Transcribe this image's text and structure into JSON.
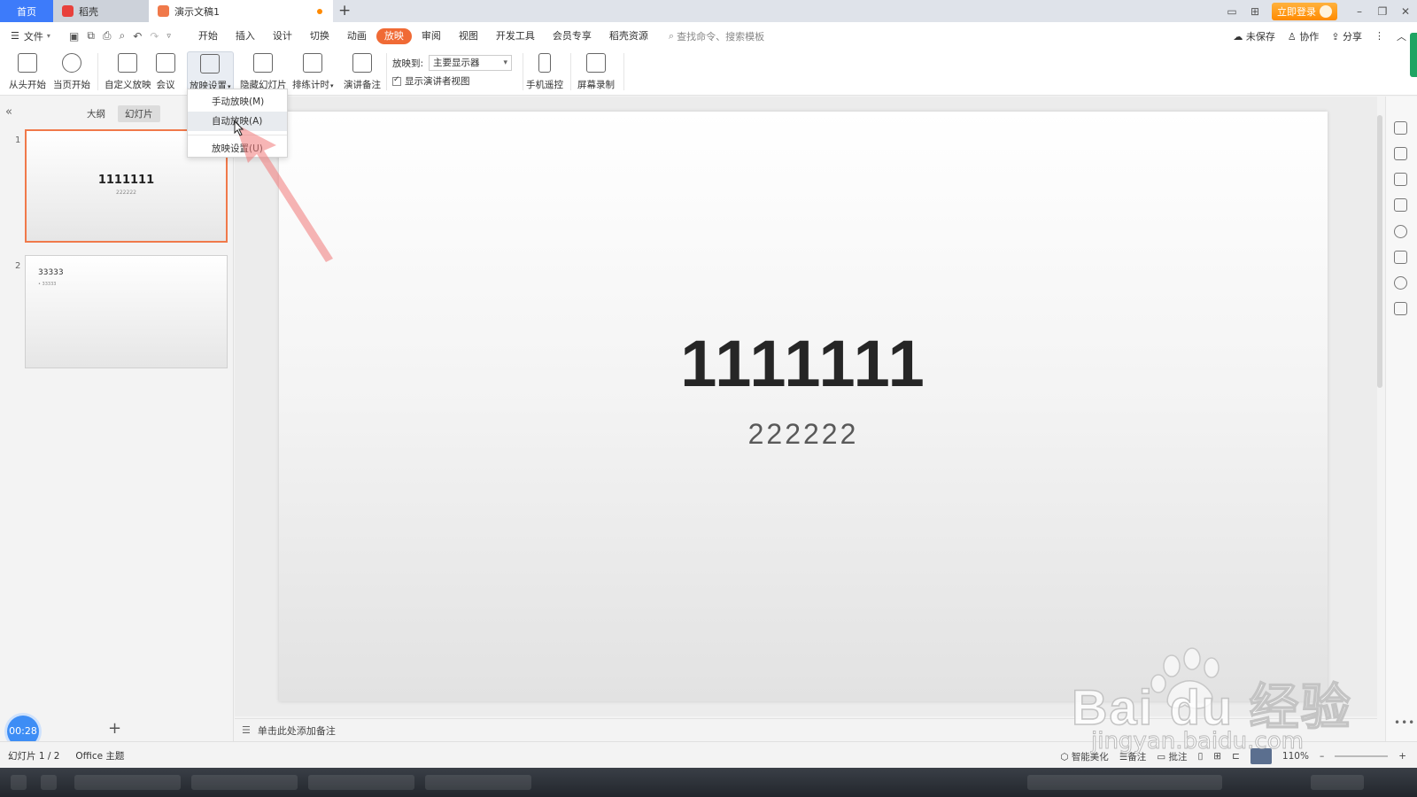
{
  "titlebar": {
    "tab_home": "首页",
    "tab_daoke": "稻壳",
    "tab_doc": "演示文稿1",
    "login": "立即登录"
  },
  "menubar": {
    "file": "文件",
    "items": [
      "开始",
      "插入",
      "设计",
      "切换",
      "动画",
      "放映",
      "审阅",
      "视图",
      "开发工具",
      "会员专享",
      "稻壳资源"
    ],
    "active": "放映",
    "search_placeholder": "查找命令、搜索模板",
    "unsaved": "未保存",
    "collab": "协作",
    "share": "分享"
  },
  "ribbon": {
    "from_start": "从头开始",
    "from_current": "当页开始",
    "custom_show": "自定义放映",
    "meeting": "会议",
    "show_settings": "放映设置",
    "hide_slide": "隐藏幻灯片",
    "rehearse": "排练计时",
    "speaker_notes": "演讲备注",
    "show_to_label": "放映到:",
    "show_to_value": "主要显示器",
    "presenter_view": "显示演讲者视图",
    "phone_remote": "手机遥控",
    "screen_record": "屏幕录制"
  },
  "dropdown": {
    "items": [
      "手动放映(M)",
      "自动放映(A)",
      "放映设置(U)"
    ],
    "hovered": "自动放映(A)"
  },
  "left_panel": {
    "tab_outline": "大纲",
    "tab_slides": "幻灯片",
    "slides": [
      {
        "num": "1",
        "title": "1111111",
        "subtitle": "222222"
      },
      {
        "num": "2",
        "title": "33333",
        "bullet": "• 33333"
      }
    ],
    "timer": "00:28"
  },
  "slide": {
    "title": "1111111",
    "subtitle": "222222"
  },
  "notes_placeholder": "单击此处添加备注",
  "statusbar": {
    "slide_count": "幻灯片 1 / 2",
    "theme": "Office 主题",
    "smart_beautify": "智能美化",
    "notes": "备注",
    "comments": "批注",
    "zoom": "110%"
  },
  "watermark": {
    "brand": "Bai du 经验",
    "url": "jingyan.baidu.com"
  },
  "colors": {
    "accent_orange": "#f06a35",
    "tab_blue": "#3d7bfa",
    "login_orange": "#ff8a00"
  }
}
